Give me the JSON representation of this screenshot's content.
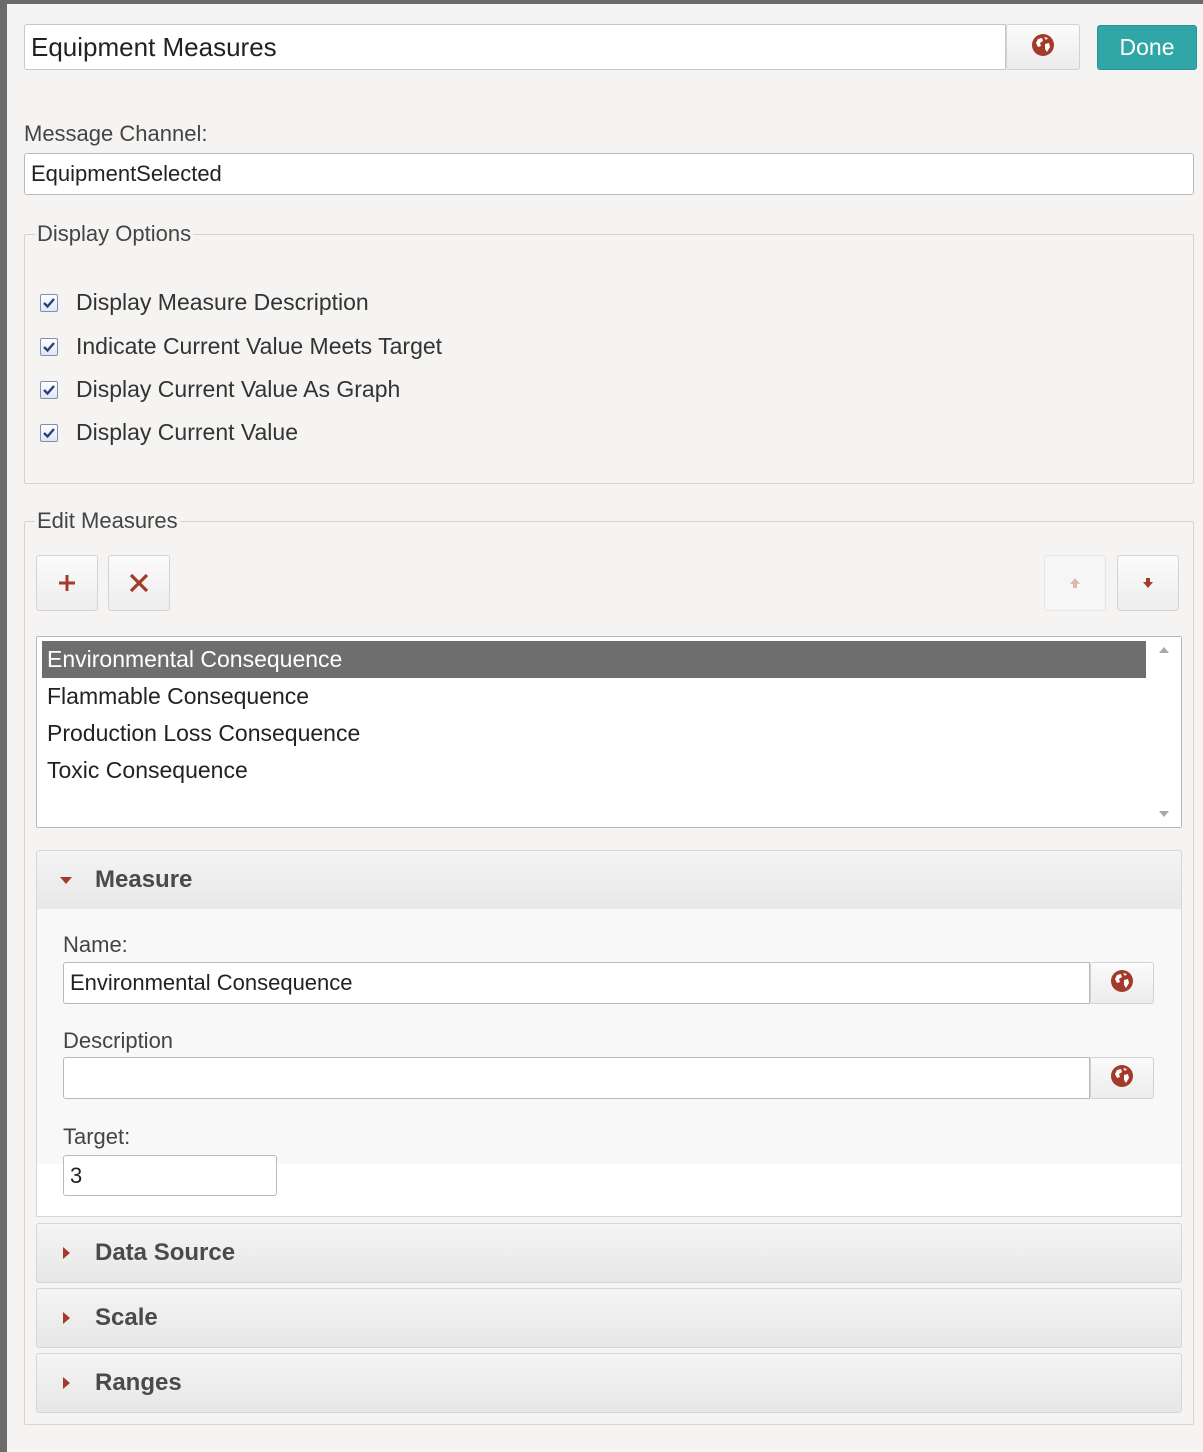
{
  "header": {
    "title_value": "Equipment Measures",
    "translate_icon": "globe-icon",
    "done_label": "Done"
  },
  "message_channel": {
    "label": "Message Channel:",
    "value": "EquipmentSelected"
  },
  "display_options": {
    "legend": "Display Options",
    "items": [
      {
        "label": "Display Measure Description",
        "checked": true
      },
      {
        "label": "Indicate Current Value Meets Target",
        "checked": true
      },
      {
        "label": "Display Current Value As Graph",
        "checked": true
      },
      {
        "label": "Display Current Value",
        "checked": true
      }
    ]
  },
  "edit_measures": {
    "legend": "Edit Measures",
    "toolbar": {
      "add_icon": "plus-icon",
      "delete_icon": "close-icon",
      "move_up_icon": "arrow-up-icon",
      "move_down_icon": "arrow-down-icon"
    },
    "measures": [
      "Environmental Consequence",
      "Flammable Consequence",
      "Production Loss Consequence",
      "Toxic Consequence"
    ],
    "selected": "Environmental Consequence"
  },
  "measure_section": {
    "title": "Measure",
    "expanded": true,
    "name_label": "Name:",
    "name_value": "Environmental Consequence",
    "description_label": "Description",
    "description_value": "",
    "target_label": "Target:",
    "target_value": "3"
  },
  "collapsed_sections": [
    "Data Source",
    "Scale",
    "Ranges"
  ],
  "colors": {
    "accent_done": "#31a6a6",
    "icon_red": "#a33a2a",
    "selection": "#6e6e6e"
  }
}
